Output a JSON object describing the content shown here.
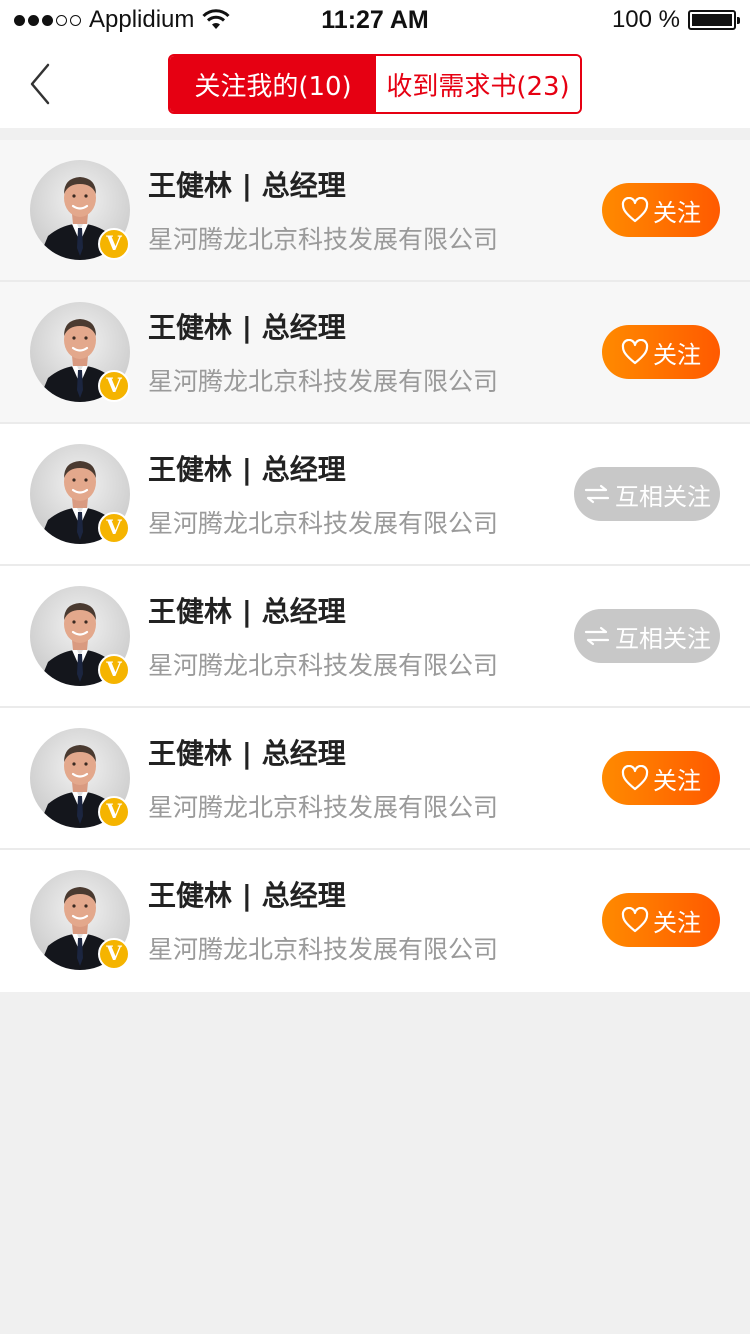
{
  "status_bar": {
    "carrier": "Applidium",
    "time": "11:27 AM",
    "battery": "100 %"
  },
  "nav": {
    "tabs": [
      {
        "label": "关注我的(10)",
        "active": true
      },
      {
        "label": "收到需求书(23)",
        "active": false
      }
    ]
  },
  "colors": {
    "accent_red": "#e60012",
    "follow_orange": "#ff6a00",
    "mutual_gray": "#c8c8c8",
    "badge_gold": "#f5b400"
  },
  "list": {
    "items": [
      {
        "name": "王健林 |  总经理",
        "company": "星河腾龙北京科技发展有限公司",
        "badge": "V",
        "button": "关注",
        "state": "follow",
        "icon": "heart-icon"
      },
      {
        "name": "王健林 |  总经理",
        "company": "星河腾龙北京科技发展有限公司",
        "badge": "V",
        "button": "关注",
        "state": "follow",
        "icon": "heart-icon"
      },
      {
        "name": "王健林 |  总经理",
        "company": "星河腾龙北京科技发展有限公司",
        "badge": "V",
        "button": "互相关注",
        "state": "mutual",
        "icon": "mutual-arrows-icon"
      },
      {
        "name": "王健林 |  总经理",
        "company": "星河腾龙北京科技发展有限公司",
        "badge": "V",
        "button": "互相关注",
        "state": "mutual",
        "icon": "mutual-arrows-icon"
      },
      {
        "name": "王健林 |  总经理",
        "company": "星河腾龙北京科技发展有限公司",
        "badge": "V",
        "button": "关注",
        "state": "follow",
        "icon": "heart-icon"
      },
      {
        "name": "王健林 |  总经理",
        "company": "星河腾龙北京科技发展有限公司",
        "badge": "V",
        "button": "关注",
        "state": "follow",
        "icon": "heart-icon"
      }
    ]
  }
}
